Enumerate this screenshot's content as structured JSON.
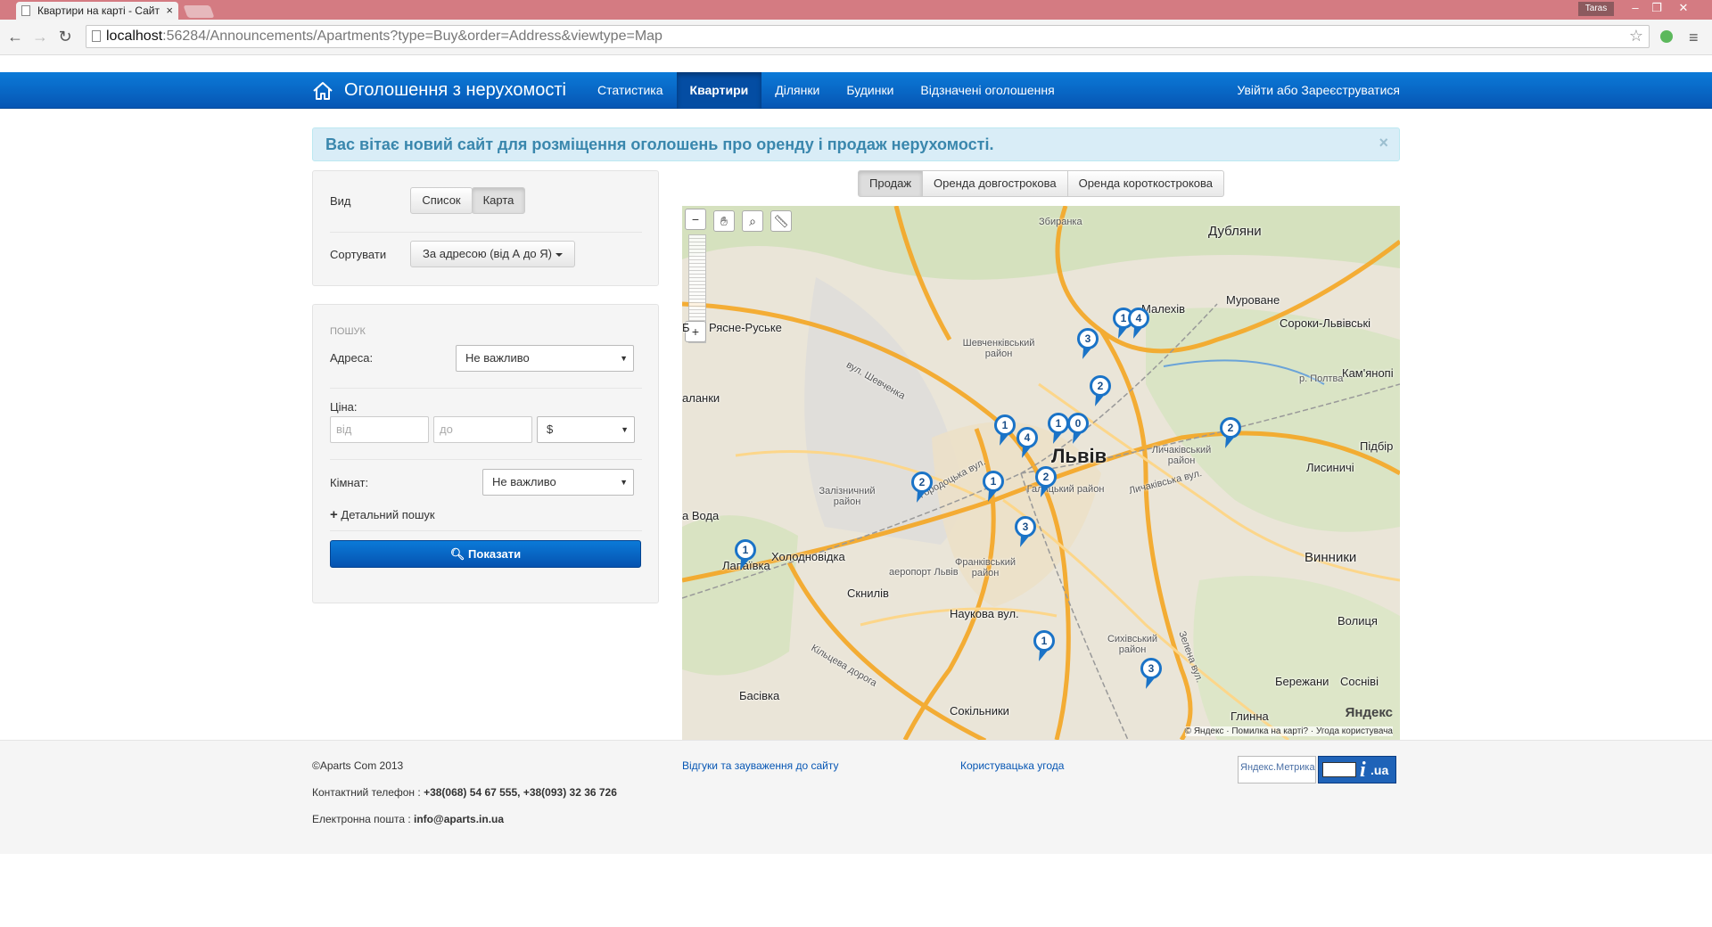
{
  "browser": {
    "tab_title": "Квартири на карті - Сайт",
    "url_host": "localhost",
    "url_rest": ":56284/Announcements/Apartments?type=Buy&order=Address&viewtype=Map",
    "user": "Taras"
  },
  "navbar": {
    "brand": "Оголошення з нерухомості",
    "items": [
      {
        "label": "Статистика"
      },
      {
        "label": "Квартири",
        "active": true
      },
      {
        "label": "Ділянки"
      },
      {
        "label": "Будинки"
      },
      {
        "label": "Відзначені оголошення"
      }
    ],
    "login": "Увійти або Зареєструватися"
  },
  "alert": {
    "text": "Вас вітає новий сайт для розміщення оголошень про оренду і продаж нерухомості.",
    "close": "×"
  },
  "view_panel": {
    "view_label": "Вид",
    "view_options": [
      "Список",
      "Карта"
    ],
    "active_view": "Карта",
    "sort_label": "Сортувати",
    "sort_value": "За адресою (від А до Я)"
  },
  "search_panel": {
    "heading": "ПОШУК",
    "address_label": "Адреса:",
    "address_value": "Не важливо",
    "price_label": "Ціна:",
    "price_from_placeholder": "від",
    "price_to_placeholder": "до",
    "currency": "$",
    "rooms_label": "Кімнат:",
    "rooms_value": "Не важливо",
    "advanced": "Детальний пошук",
    "submit": "Показати"
  },
  "map_tabs": [
    "Продаж",
    "Оренда довгострокова",
    "Оренда короткострокова"
  ],
  "active_map_tab": "Продаж",
  "map": {
    "labels": {
      "zbyranka": "Збиранка",
      "dubliany": "Дубляни",
      "malekhiv": "Малехів",
      "murovane": "Муроване",
      "soroky": "Сороки-Львівські",
      "riasne": "Рясне-Руське",
      "shevchenkivskyi": "Шевченківський район",
      "kamianopil": "Кам'янопі",
      "lviv": "Львів",
      "lychakivskyi": "Личаківський район",
      "pidbir": "Підбір",
      "lysynychi": "Лисиничі",
      "zaliznychnyi": "Залізничний район",
      "halytskyi": "Галицький район",
      "vynnyky": "Винники",
      "volytsia": "Волиця",
      "voda": "а Вода",
      "lapaivka": "Лапаївка",
      "kholodnovidka": "Холодновідка",
      "skniliv": "Сокільники",
      "sknyliv": "Скнилів",
      "airport": "аеропорт Львів",
      "frankivskyi": "Франківський район",
      "naukova": "Наукова вул.",
      "sykhivskyi": "Сихівський район",
      "berezhany": "Бережани",
      "sosniv": "Сосніві",
      "basivka": "Басівка",
      "hlynna": "Глинна",
      "shevchenka_st": "вул. Шевченка",
      "horodotska_st": "Городоцька вул.",
      "lychakivska_st": "Личаківська вул.",
      "kiltseva": "Кільцева дорога",
      "zelena": "Зелена вул.",
      "poltva": "р. Полтва",
      "lanany": "аланки"
    },
    "markers": [
      "1",
      "4",
      "3",
      "2",
      "1",
      "4",
      "1",
      "0",
      "2",
      "2",
      "1",
      "2",
      "3",
      "1",
      "1",
      "3"
    ],
    "logo": "Яндекс",
    "copyright": "© Яндекс · Помилка на карті? · Угода користувача"
  },
  "footer": {
    "copyright": "©Aparts Com 2013",
    "phone_label": "Контактний телефон : ",
    "phone_value": "+38(068) 54 67 555, +38(093) 32 36 726",
    "email_label": "Електронна пошта : ",
    "email_value": "info@aparts.in.ua",
    "feedback_link": "Відгуки та зауваження до сайту",
    "terms_link": "Користувацька угода",
    "metrika_alt": "Яндекс.Метрика",
    "iua": ".ua"
  }
}
